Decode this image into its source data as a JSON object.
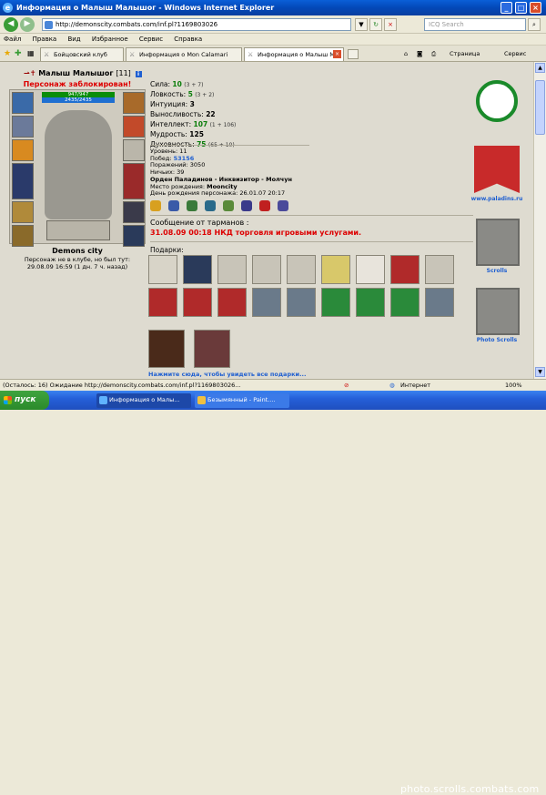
{
  "window": {
    "title": "Информация о Малыш Малышог - Windows Internet Explorer"
  },
  "address_bar": {
    "url": "http://demonscity.combats.com/inf.pl?1169803026",
    "search_placeholder": "ICQ Search"
  },
  "menu": [
    "Файл",
    "Правка",
    "Вид",
    "Избранное",
    "Сервис",
    "Справка"
  ],
  "tabs": [
    {
      "label": "Бойцовский клуб"
    },
    {
      "label": "Информация о Mon Calamari"
    },
    {
      "label": "Информация о Малыш М..."
    }
  ],
  "toolbar_right": {
    "page_label": "Страница",
    "tools_label": "Сервис"
  },
  "character": {
    "name": "Малыш Малышог",
    "level": "[11]",
    "blocked_text": "Персонаж заблокирован!",
    "hp": "947/947",
    "mp": "2435/2435",
    "city": "Demons city",
    "location_line1": "Персонаж не в клубе, но был тут:",
    "location_line2": "29.08.09 16:59 (1 дн. 7 ч. назад)"
  },
  "stats": [
    {
      "label": "Сила:",
      "value": "10",
      "bonus": "(3 + 7)"
    },
    {
      "label": "Ловкость:",
      "value": "5",
      "bonus": "(3 + 2)"
    },
    {
      "label": "Интуиция:",
      "value": "3",
      "bonus": ""
    },
    {
      "label": "Выносливость:",
      "value": "22",
      "bonus": ""
    },
    {
      "label": "Интеллект:",
      "value": "107",
      "bonus": "(1 + 106)"
    },
    {
      "label": "Мудрость:",
      "value": "125",
      "bonus": ""
    },
    {
      "label": "Духовность:",
      "value": "75",
      "bonus": "(65 + 10)"
    }
  ],
  "meta": {
    "level": "Уровень: 11",
    "wins_label": "Побед:",
    "wins": "53156",
    "losses": "Поражений: 3050",
    "draws": "Ничьих: 39",
    "order": "Орден Паладинов - Инквизитор - Молчун",
    "birthplace_label": "Место рождения:",
    "birthplace": "Mooncity",
    "birthday": "День рождения персонажа: 26.01.07 20:17"
  },
  "message": {
    "header": "Сообщение от тарманов :",
    "text": "31.08.09 00:18 НКД торговля игровыми услугами."
  },
  "gifts": {
    "header": "Подарки:",
    "link": "Нажмите сюда, чтобы увидеть все подарки..."
  },
  "right_column": {
    "paladins_label": "www.paladins.ru",
    "scrolls_label": "Scrolls",
    "photo_scrolls_label": "Photo Scrolls"
  },
  "status_bar": {
    "text": "(Осталось: 16) Ожидание http://demonscity.combats.com/inf.pl?1169803026...",
    "zone": "Интернет",
    "zoom": "100%"
  },
  "taskbar": {
    "start": "пуск",
    "items": [
      "Информация о Малы...",
      "Безымянный - Paint...."
    ],
    "watermark": "photo.scrolls.combats.com"
  },
  "colors": {
    "hp": "#0a8d0a",
    "mp": "#1f6fd1",
    "blocked": "#dd0000",
    "link": "#1f5fd1"
  }
}
